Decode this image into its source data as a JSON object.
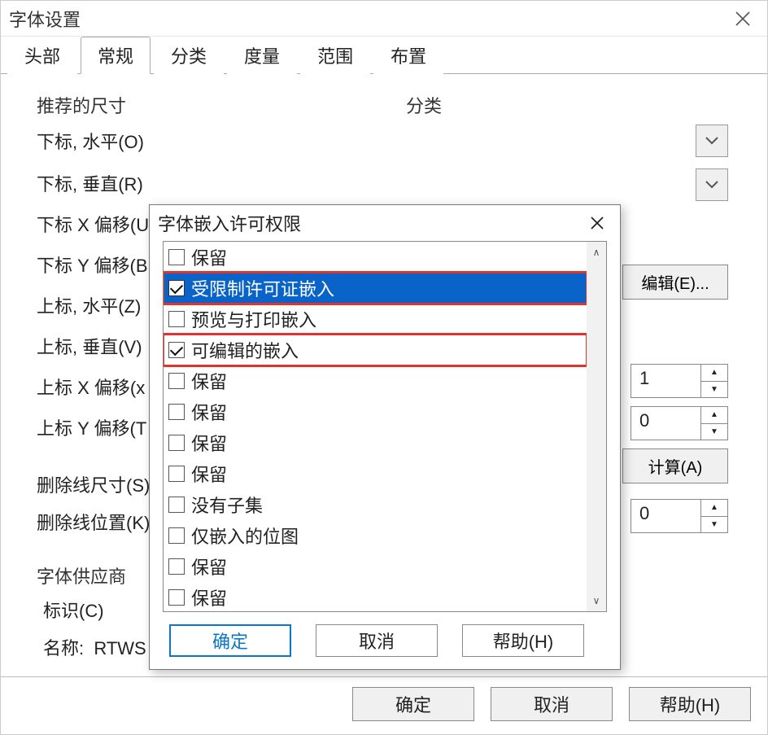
{
  "window": {
    "title": "字体设置"
  },
  "tabs": [
    "头部",
    "常规",
    "分类",
    "度量",
    "范围",
    "布置"
  ],
  "active_tab": 1,
  "labels": {
    "group_recommended": "推荐的尺寸",
    "group_category": "分类",
    "sub_horiz": "下标, 水平(O)",
    "sub_vert": "下标, 垂直(R)",
    "sub_xoff": "下标 X 偏移(U",
    "sub_yoff": "下标 Y 偏移(B",
    "sup_horiz": "上标, 水平(Z)",
    "sup_vert": "上标, 垂直(V)",
    "sup_xoff": "上标 X 偏移(x",
    "sup_yoff": "上标 Y 偏移(T",
    "strike_size": "删除线尺寸(S)",
    "strike_pos": "删除线位置(K)",
    "vendor_group": "字体供应商",
    "vendor_id": "标识(C)",
    "vendor_name_lbl": "名称:",
    "vendor_name_val": "RTWS",
    "vendor_combo": "RTWS"
  },
  "right": {
    "edit_btn": "编辑(E)...",
    "calc_btn": "计算(A)",
    "spin1": "1",
    "spin2": "0",
    "spin3": "0"
  },
  "main_buttons": {
    "ok": "确定",
    "cancel": "取消",
    "help": "帮助(H)"
  },
  "modal": {
    "title": "字体嵌入许可权限",
    "items": [
      {
        "label": "保留",
        "checked": false,
        "selected": false,
        "red": false
      },
      {
        "label": "受限制许可证嵌入",
        "checked": true,
        "selected": true,
        "red": true
      },
      {
        "label": "预览与打印嵌入",
        "checked": false,
        "selected": false,
        "red": false
      },
      {
        "label": "可编辑的嵌入",
        "checked": true,
        "selected": false,
        "red": true
      },
      {
        "label": "保留",
        "checked": false,
        "selected": false,
        "red": false
      },
      {
        "label": "保留",
        "checked": false,
        "selected": false,
        "red": false
      },
      {
        "label": "保留",
        "checked": false,
        "selected": false,
        "red": false
      },
      {
        "label": "保留",
        "checked": false,
        "selected": false,
        "red": false
      },
      {
        "label": "没有子集",
        "checked": false,
        "selected": false,
        "red": false
      },
      {
        "label": "仅嵌入的位图",
        "checked": false,
        "selected": false,
        "red": false
      },
      {
        "label": "保留",
        "checked": false,
        "selected": false,
        "red": false
      },
      {
        "label": "保留",
        "checked": false,
        "selected": false,
        "red": false
      }
    ],
    "buttons": {
      "ok": "确定",
      "cancel": "取消",
      "help": "帮助(H)"
    }
  }
}
